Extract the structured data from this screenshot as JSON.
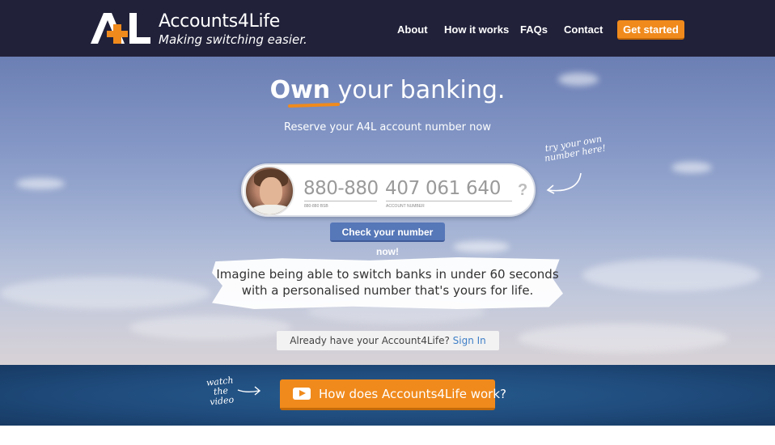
{
  "header": {
    "logo_text": "A4L",
    "brand": "Accounts4Life",
    "tagline": "Making switching easier.",
    "nav": [
      {
        "label": "About"
      },
      {
        "label": "How it works"
      },
      {
        "label": "FAQs"
      },
      {
        "label": "Contact"
      }
    ],
    "cta": "Get started"
  },
  "hero": {
    "headline_bold": "Own",
    "headline_rest": " your banking.",
    "subheadline": "Reserve your A4L account number now",
    "try_note": "try your own number here!",
    "number_box": {
      "bsb_value": "880-880",
      "bsb_label": "880-880 BSB",
      "account_value": "407 061 640",
      "account_label": "ACCOUNT NUMBER",
      "help": "?"
    },
    "check_button": "Check your number now!",
    "pitch": "Imagine being able to switch banks in under 60 seconds with a personalised number that's yours for life.",
    "signin_prompt": "Already have your Account4Life?",
    "signin_link": "Sign In"
  },
  "video": {
    "note": "watch the video",
    "button": "How does Accounts4Life work?"
  },
  "colors": {
    "header_bg": "#21213a",
    "accent_orange": "#f08a1c",
    "button_blue": "#5677b8",
    "band_blue": "#1f4b7c",
    "link_blue": "#3f7fc7"
  }
}
